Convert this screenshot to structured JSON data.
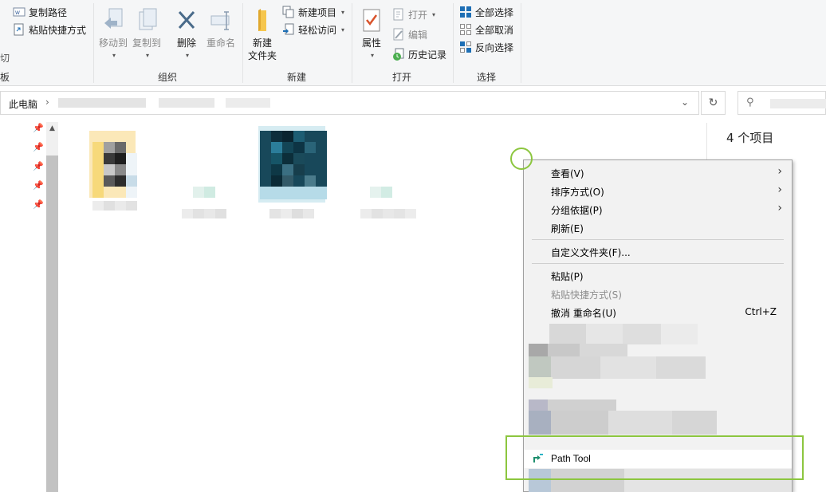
{
  "ribbon": {
    "clipboard": {
      "copy_path": "复制路径",
      "paste_shortcut": "粘贴快捷方式",
      "cut_partial": "切",
      "board_partial": "板"
    },
    "organize": {
      "move_to": "移动到",
      "copy_to": "复制到",
      "delete": "删除",
      "rename": "重命名",
      "group_label": "组织"
    },
    "new": {
      "new_folder_line1": "新建",
      "new_folder_line2": "文件夹",
      "new_item": "新建项目",
      "easy_access": "轻松访问",
      "group_label": "新建"
    },
    "open": {
      "properties": "属性",
      "open": "打开",
      "edit": "编辑",
      "history": "历史记录",
      "group_label": "打开"
    },
    "select": {
      "select_all": "全部选择",
      "select_none": "全部取消",
      "invert_selection": "反向选择",
      "group_label": "选择"
    }
  },
  "address_bar": {
    "root": "此电脑"
  },
  "details": {
    "item_count": "4 个项目"
  },
  "context_menu": {
    "items": [
      {
        "label": "查看(V)"
      },
      {
        "label": "排序方式(O)"
      },
      {
        "label": "分组依据(P)"
      },
      {
        "label": "刷新(E)"
      },
      {
        "label": "自定义文件夹(F)..."
      },
      {
        "label": "粘贴(P)"
      },
      {
        "label": "粘贴快捷方式(S)"
      },
      {
        "label": "撤消 重命名(U)",
        "shortcut": "Ctrl+Z"
      }
    ],
    "path_tool": "Path Tool"
  },
  "colors": {
    "annotation": "#8cc63f",
    "accent": "#1e6fb5"
  }
}
